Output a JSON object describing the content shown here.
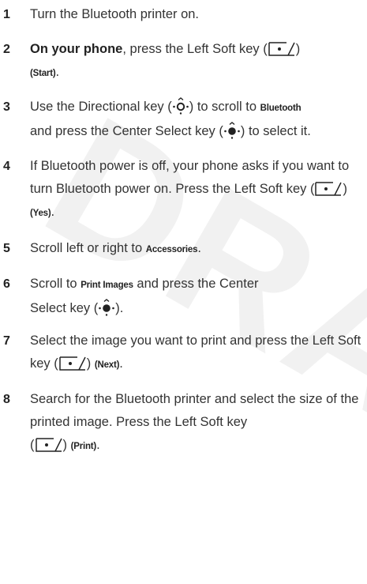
{
  "watermark": "DRAFT",
  "steps": [
    {
      "number": "1",
      "text": "Turn the Bluetooth printer on."
    },
    {
      "number": "2",
      "lead": "On your phone",
      "text_a": ", press the Left Soft key (",
      "text_b": ")",
      "key_label": "(Start)",
      "text_c": "."
    },
    {
      "number": "3",
      "text_a": "Use the Directional key (",
      "text_b": ") to scroll to ",
      "target": "Bluetooth",
      "text_c": "and press the Center Select key (",
      "text_d": ") to select it."
    },
    {
      "number": "4",
      "text_a": "If Bluetooth power is off, your phone asks if you want to turn Bluetooth power on. Press the Left Soft key (",
      "text_b": ") ",
      "key_label": "(Yes)",
      "text_c": "."
    },
    {
      "number": "5",
      "text_a": "Scroll left or right to ",
      "target": "Accessories",
      "text_b": "."
    },
    {
      "number": "6",
      "text_a": "Scroll to ",
      "target": "Print Images",
      "text_b": " and press the Center",
      "text_c": "Select key (",
      "text_d": ")."
    },
    {
      "number": "7",
      "text_a": "Select the image you want to print and press the Left Soft key (",
      "text_b": ") ",
      "key_label": "(Next)",
      "text_c": "."
    },
    {
      "number": "8",
      "text_a": "Search for the Bluetooth printer and select the size of the printed image. Press the Left Soft key",
      "text_b": "(",
      "text_c": ") ",
      "key_label": "(Print)",
      "text_d": "."
    }
  ],
  "icons": {
    "left_soft_key": "left-soft-key-icon",
    "directional_key": "directional-key-icon",
    "center_select_key": "center-select-key-icon"
  }
}
